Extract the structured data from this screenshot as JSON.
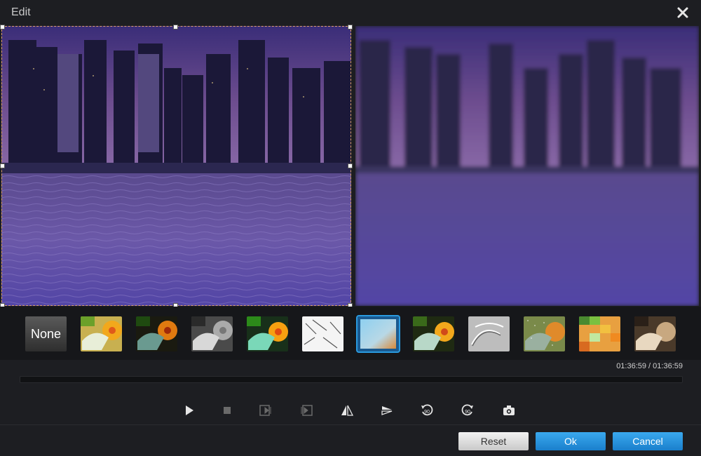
{
  "window": {
    "title": "Edit"
  },
  "filters": {
    "none_label": "None",
    "items": [
      {
        "name": "filter-none"
      },
      {
        "name": "filter-warm"
      },
      {
        "name": "filter-dark-contrast"
      },
      {
        "name": "filter-grayscale"
      },
      {
        "name": "filter-vivid"
      },
      {
        "name": "filter-sketch"
      },
      {
        "name": "filter-gradient-blur"
      },
      {
        "name": "filter-normal"
      },
      {
        "name": "filter-emboss"
      },
      {
        "name": "filter-noise"
      },
      {
        "name": "filter-mosaic"
      },
      {
        "name": "filter-sepia"
      }
    ],
    "selected": "filter-gradient-blur"
  },
  "playback": {
    "time": "01:36:59 / 01:36:59",
    "progress": 0
  },
  "controls": {
    "icons": [
      "play-icon",
      "stop-icon",
      "previous-frame-icon",
      "next-frame-icon",
      "flip-horizontal-icon",
      "flip-vertical-icon",
      "rotate-left-90-icon",
      "rotate-right-90-icon",
      "snapshot-icon"
    ],
    "rotate_label": "90"
  },
  "buttons": {
    "reset": "Reset",
    "ok": "Ok",
    "cancel": "Cancel"
  },
  "colors": {
    "accent": "#1a7fcc",
    "selection_border": "#2a9be0"
  }
}
